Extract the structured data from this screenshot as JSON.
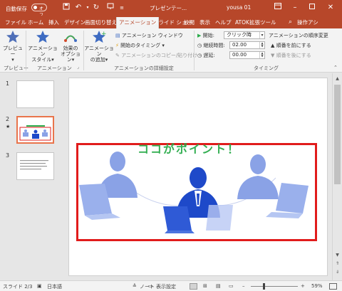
{
  "titlebar": {
    "autosave_label": "自動保存",
    "autosave_state": "オフ",
    "doc_title": "プレゼンテー...",
    "user": "yousa 01",
    "accent": "#b7472a"
  },
  "tabs": [
    "ファイル",
    "ホーム",
    "挿入",
    "デザイン",
    "画面切り替え",
    "アニメーション",
    "スライド ショー",
    "校閲",
    "表示",
    "ヘルプ",
    "ATOK拡張ツール",
    "操作アシ"
  ],
  "ribbon": {
    "preview": {
      "label": "プレビュー",
      "group": "プレビュー"
    },
    "anim_style": {
      "label1": "アニメーション",
      "label2": "スタイル"
    },
    "effect_options": {
      "label1": "効果の",
      "label2": "オプション"
    },
    "anim_group": "アニメーション",
    "add_anim": {
      "label1": "アニメーション",
      "label2": "の追加"
    },
    "anim_window": "アニメーション ウィンドウ",
    "start_timing": "開始のタイミング",
    "anim_painter": "アニメーションのコピー/貼り付け",
    "advanced_group": "アニメーションの詳細設定",
    "start_label": "開始:",
    "start_value": "クリック時",
    "duration_label": "継続時間:",
    "duration_value": "02.00",
    "delay_label": "遅延:",
    "delay_value": "00.00",
    "reorder_title": "アニメーションの順序変更",
    "move_earlier": "順番を前にする",
    "move_later": "順番を後にする",
    "timing_group": "タイミング"
  },
  "thumbnails": [
    {
      "num": "1",
      "star": ""
    },
    {
      "num": "2",
      "star": "★"
    },
    {
      "num": "3",
      "star": ""
    }
  ],
  "slide": {
    "title": "ココがポイント！",
    "title_color": "#2aab4a",
    "highlight_color": "#e11c1c"
  },
  "status": {
    "slide_count": "スライド 2/3",
    "language": "日本語",
    "notes": "ノート",
    "display_settings": "表示設定",
    "zoom": "59%",
    "zoom_fraction": 0.59
  }
}
